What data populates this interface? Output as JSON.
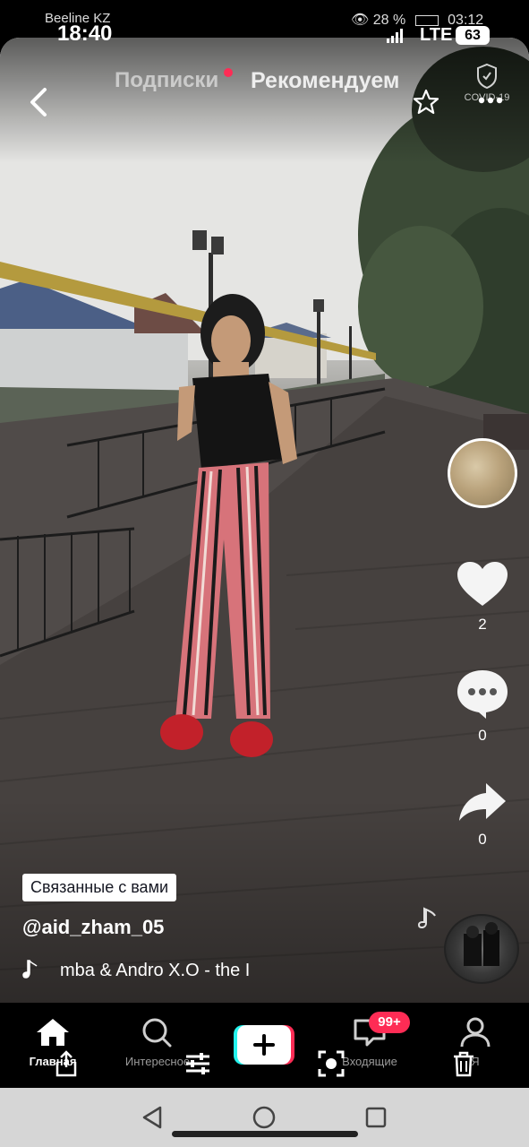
{
  "status_bar": {
    "time": "18:40",
    "network": "LTE",
    "battery": "63"
  },
  "recorded_status": {
    "carrier": "Beeline KZ",
    "battery_pct": "28 %",
    "time": "03:12"
  },
  "top_bar": {
    "tabs": [
      {
        "label": "Подписки",
        "active": false,
        "has_dot": true
      },
      {
        "label": "Рекомендуем",
        "active": true
      }
    ],
    "badge_label": "COVID-19"
  },
  "video": {
    "likes": "2",
    "comments": "0",
    "shares": "0"
  },
  "caption": {
    "tag_chip": "Связанные с вами",
    "username": "@aid_zham_05",
    "music_text": "mba & Andro    X.O - the I"
  },
  "bottom_nav": {
    "items": [
      {
        "label": "Главная",
        "icon": "home-icon",
        "active": true
      },
      {
        "label": "Интересное",
        "icon": "search-icon",
        "active": false
      },
      {
        "label": "",
        "icon": "plus-icon",
        "active": false
      },
      {
        "label": "Входящие",
        "icon": "inbox-icon",
        "active": false,
        "badge": "99+"
      },
      {
        "label": "Я",
        "icon": "profile-icon",
        "active": false
      }
    ]
  },
  "colors": {
    "accent_red": "#fe2c55",
    "accent_cyan": "#25f4ee",
    "background": "#000000"
  }
}
